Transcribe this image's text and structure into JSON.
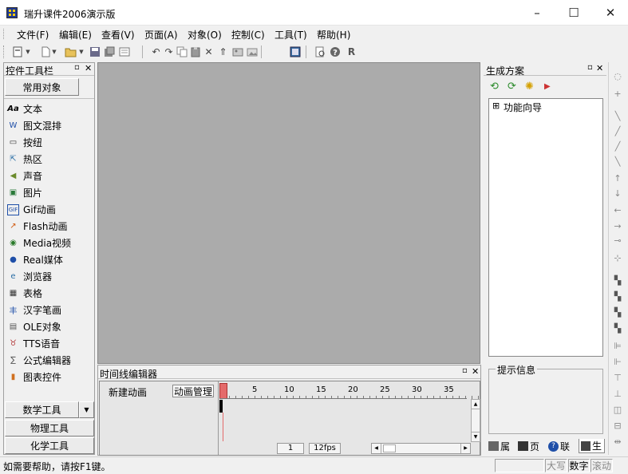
{
  "window": {
    "title": "瑞升课件2006演示版",
    "minimize": "–",
    "maximize": "☐",
    "close": "✕"
  },
  "menu": [
    "文件(F)",
    "编辑(E)",
    "查看(V)",
    "页面(A)",
    "对象(O)",
    "控制(C)",
    "工具(T)",
    "帮助(H)"
  ],
  "toolbox": {
    "title": "控件工具栏",
    "pin": "ᵖ",
    "close": "✕",
    "common_tab": "常用对象",
    "items": [
      {
        "label": "文本",
        "icon": "text-icon",
        "glyph": "Aa"
      },
      {
        "label": "图文混排",
        "icon": "mixed-icon",
        "glyph": "W"
      },
      {
        "label": "按纽",
        "icon": "button-icon",
        "glyph": "▭"
      },
      {
        "label": "热区",
        "icon": "hotspot-icon",
        "glyph": "⇱"
      },
      {
        "label": "声音",
        "icon": "sound-icon",
        "glyph": "◀"
      },
      {
        "label": "图片",
        "icon": "picture-icon",
        "glyph": "▣"
      },
      {
        "label": "Gif动画",
        "icon": "gif-icon",
        "glyph": "GIF"
      },
      {
        "label": "Flash动画",
        "icon": "flash-icon",
        "glyph": "↗"
      },
      {
        "label": "Media视频",
        "icon": "media-icon",
        "glyph": "◉"
      },
      {
        "label": "Real媒体",
        "icon": "real-icon",
        "glyph": "●"
      },
      {
        "label": "浏览器",
        "icon": "browser-icon",
        "glyph": "e"
      },
      {
        "label": "表格",
        "icon": "table-icon",
        "glyph": "▦"
      },
      {
        "label": "汉字笔画",
        "icon": "stroke-icon",
        "glyph": "丰"
      },
      {
        "label": "OLE对象",
        "icon": "ole-icon",
        "glyph": "▤"
      },
      {
        "label": "TTS语音",
        "icon": "tts-icon",
        "glyph": "♉"
      },
      {
        "label": "公式编辑器",
        "icon": "formula-icon",
        "glyph": "∑"
      },
      {
        "label": "图表控件",
        "icon": "chart-icon",
        "glyph": "▮"
      }
    ],
    "bottom_tabs": [
      "数学工具",
      "物理工具",
      "化学工具"
    ],
    "dropdown_arrow": "▼"
  },
  "timeline": {
    "title": "时间线编辑器",
    "pin": "ᵖ",
    "close": "✕",
    "new_animation": "新建动画",
    "manage": "动画管理",
    "ruler": [
      "5",
      "10",
      "15",
      "20",
      "25",
      "30",
      "35"
    ],
    "frame": "1",
    "fps": "12fps"
  },
  "plan": {
    "title": "生成方案",
    "pin": "ᵖ",
    "close": "✕",
    "tree_expand": "⊞",
    "tree_item": "功能向导",
    "hint_title": "提示信息",
    "tabs": [
      "属",
      "页",
      "联",
      "生"
    ]
  },
  "status": {
    "help": "如需要帮助，请按F1键。",
    "caps": "大写",
    "num": "数字",
    "scroll": "滚动"
  },
  "colors": {
    "canvas": "#ababab",
    "title_bg": "#ffffff",
    "app_icon": "#1f3a93"
  }
}
